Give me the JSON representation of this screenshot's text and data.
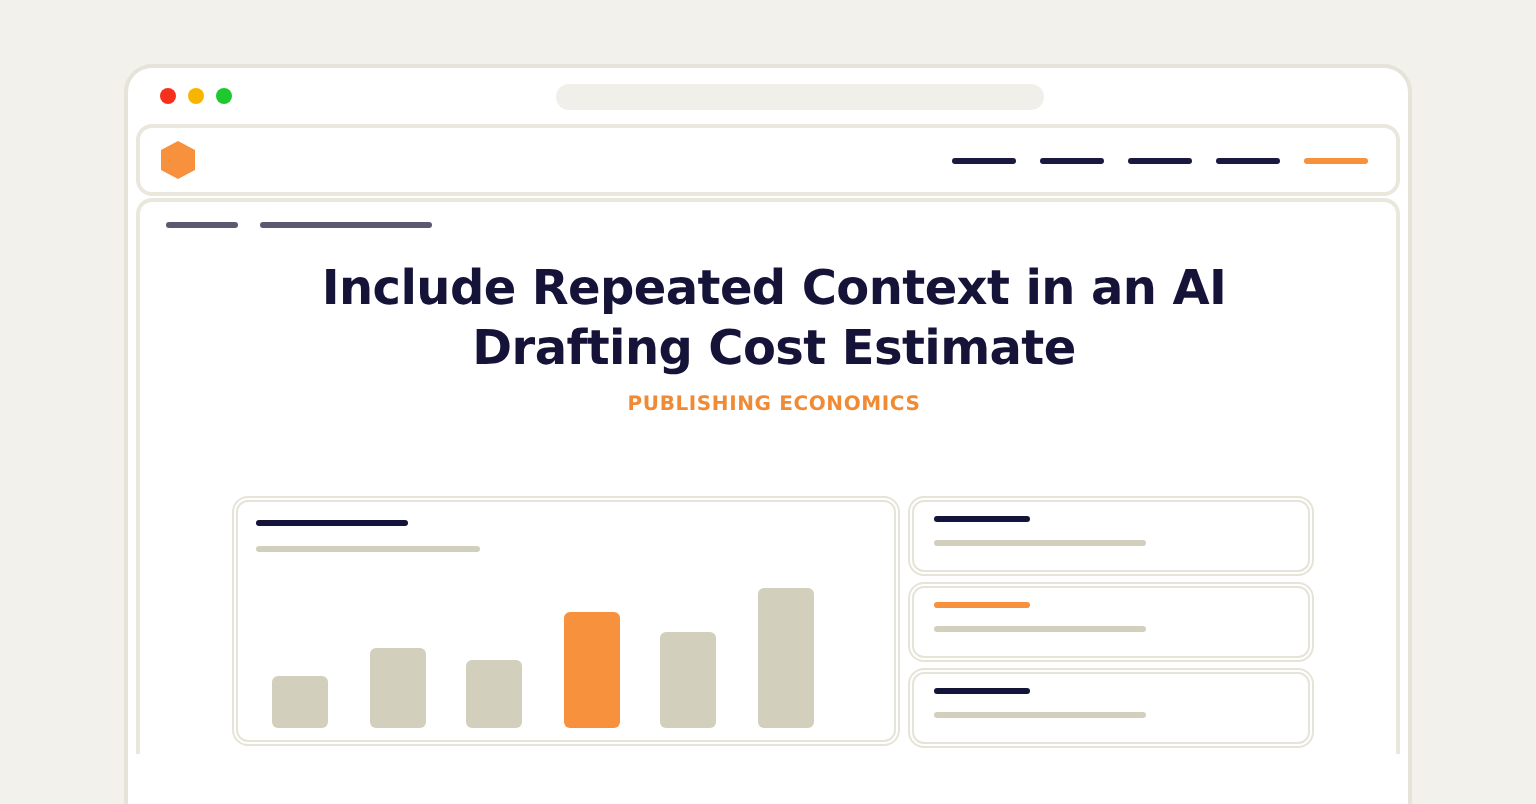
{
  "article": {
    "title": "Include Repeated Context in an AI Drafting Cost Estimate",
    "category": "PUBLISHING ECONOMICS"
  },
  "nav_links": [
    {
      "selected": false
    },
    {
      "selected": false
    },
    {
      "selected": false
    },
    {
      "selected": false
    },
    {
      "selected": true
    }
  ],
  "side_cards": [
    {
      "highlighted": false
    },
    {
      "highlighted": true
    },
    {
      "highlighted": false
    }
  ]
}
